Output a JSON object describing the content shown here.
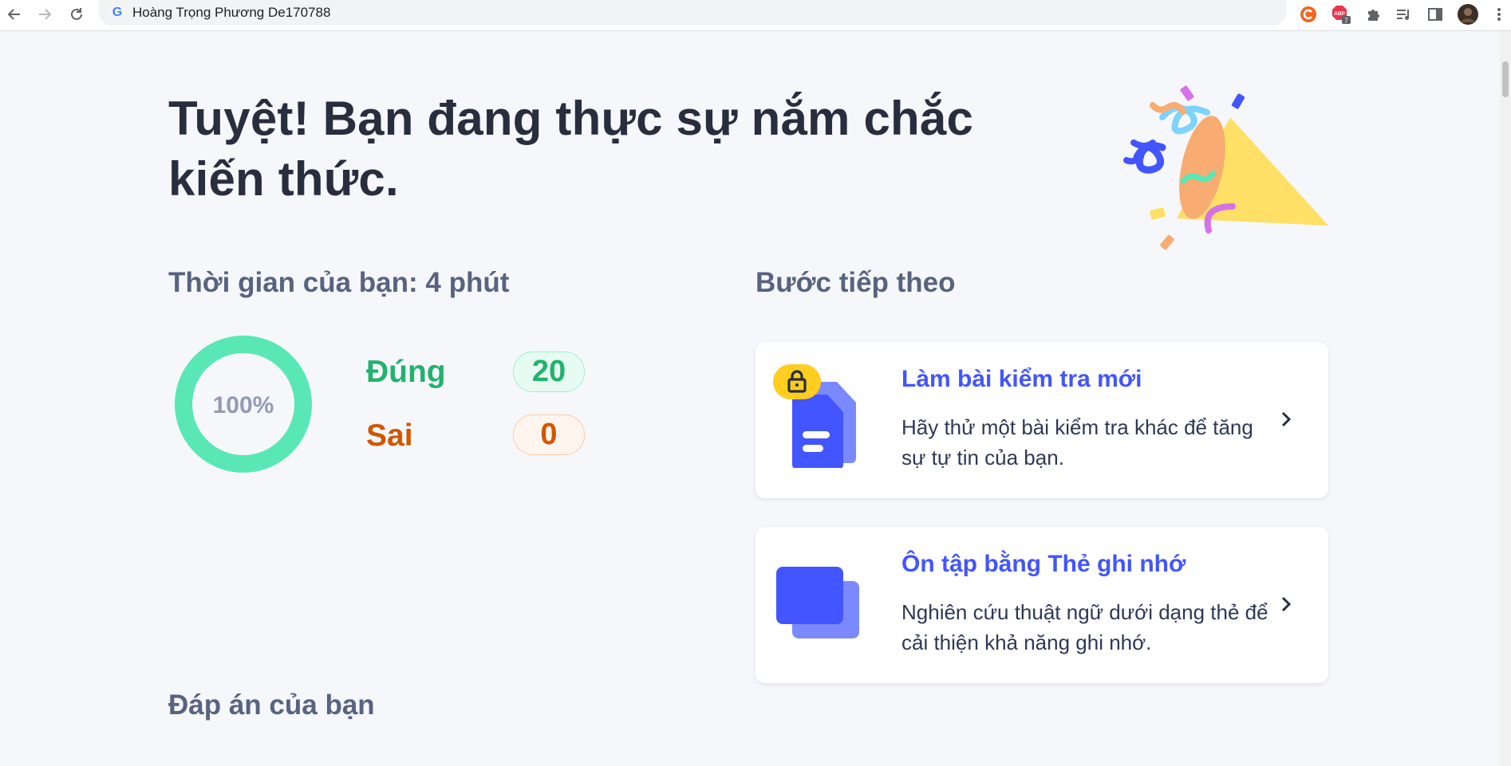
{
  "browser": {
    "address_text": "Hoàng Trọng Phương De170788",
    "google_glyph": "G",
    "adblock_label": "ABP",
    "adblock_count": "7"
  },
  "result": {
    "headline_line1": "Tuyệt! Bạn đang thực sự nắm chắc",
    "headline_line2": "kiến thức."
  },
  "time": {
    "title": "Thời gian của bạn: 4 phút"
  },
  "score": {
    "percent_label": "100%",
    "percent_value": 100,
    "correct_label": "Đúng",
    "correct_count": "20",
    "wrong_label": "Sai",
    "wrong_count": "0"
  },
  "next_steps": {
    "title": "Bước tiếp theo",
    "cards": [
      {
        "title": "Làm bài kiểm tra mới",
        "description": "Hãy thử một bài kiểm tra khác để tăng sự tự tin của bạn.",
        "icon": "locked-test-icon"
      },
      {
        "title": "Ôn tập bằng Thẻ ghi nhớ",
        "description": "Nghiên cứu thuật ngữ dưới dạng thẻ để cải thiện khả năng ghi nhớ.",
        "icon": "flashcards-icon"
      }
    ]
  },
  "answers": {
    "title": "Đáp án của bạn"
  },
  "colors": {
    "correct": "#23b26d",
    "wrong": "#d05700",
    "accent": "#4255ff",
    "ring": "#59e8b5"
  }
}
